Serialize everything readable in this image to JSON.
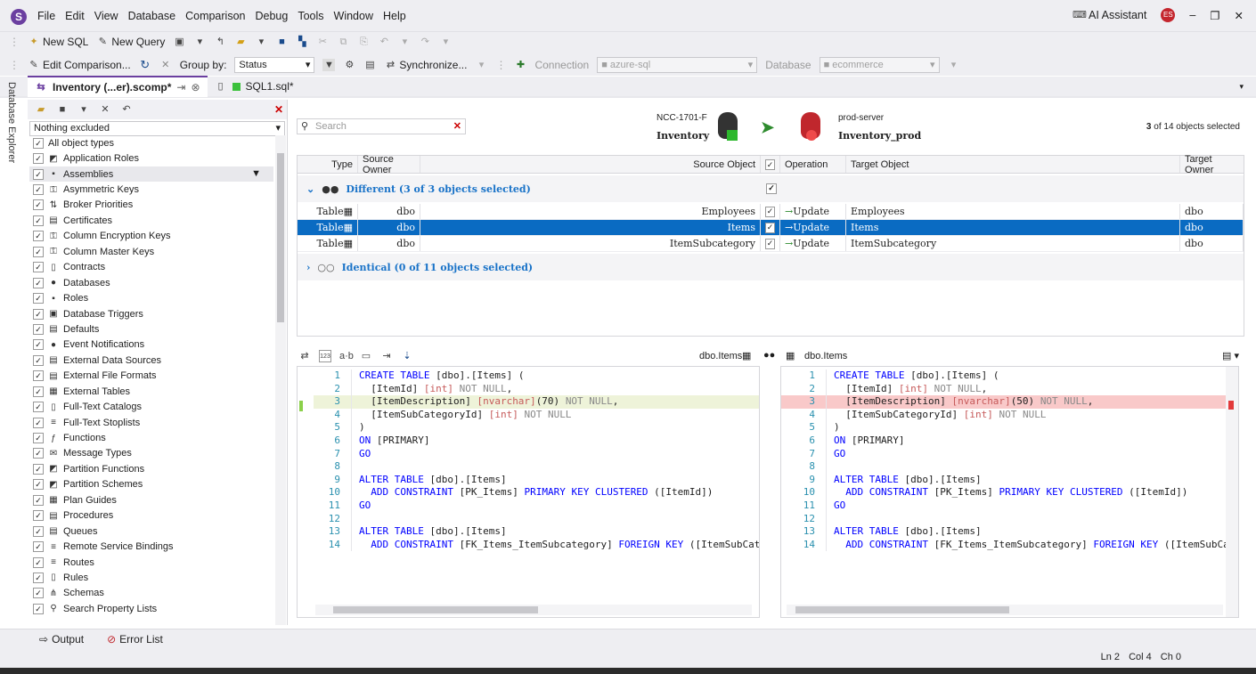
{
  "menu": {
    "items": [
      "File",
      "Edit",
      "View",
      "Database",
      "Comparison",
      "Debug",
      "Tools",
      "Window",
      "Help"
    ],
    "ai_assistant": "AI Assistant",
    "avatar_initials": "ES"
  },
  "toolbar1": {
    "new_sql": "New SQL",
    "new_query": "New Query"
  },
  "toolbar2": {
    "edit_comparison": "Edit Comparison...",
    "group_by_label": "Group by:",
    "group_by_value": "Status",
    "synchronize": "Synchronize...",
    "connection_label": "Connection",
    "connection_value": "azure-sql",
    "database_label": "Database",
    "database_value": "ecommerce"
  },
  "tabs": [
    {
      "label": "Inventory (...er).scomp*"
    },
    {
      "label": "SQL1.sql*"
    }
  ],
  "side_strip": "Database Explorer",
  "left_panel": {
    "filter_value": "Nothing excluded",
    "items": [
      "All object types",
      "Application Roles",
      "Assemblies",
      "Asymmetric Keys",
      "Broker Priorities",
      "Certificates",
      "Column Encryption Keys",
      "Column Master Keys",
      "Contracts",
      "Databases",
      "Roles",
      "Database Triggers",
      "Defaults",
      "Event Notifications",
      "External Data Sources",
      "External File Formats",
      "External Tables",
      "Full-Text Catalogs",
      "Full-Text Stoplists",
      "Functions",
      "Message Types",
      "Partition Functions",
      "Partition Schemes",
      "Plan Guides",
      "Procedures",
      "Queues",
      "Remote Service Bindings",
      "Routes",
      "Rules",
      "Schemas",
      "Search Property Lists"
    ]
  },
  "comparison": {
    "search_placeholder": "Search",
    "source_server": "NCC-1701-F",
    "source_db": "Inventory",
    "target_server": "prod-server",
    "target_db": "Inventory_prod",
    "selected_count": "3",
    "selected_suffix": "of 14 objects selected"
  },
  "grid": {
    "headers": {
      "type": "Type",
      "source_owner": "Source Owner",
      "source_object": "Source Object",
      "operation": "Operation",
      "target_object": "Target Object",
      "target_owner": "Target Owner"
    },
    "group_different": "Different (3 of 3 objects selected)",
    "group_identical": "Identical (0 of 11 objects selected)",
    "rows": [
      {
        "type": "Table",
        "source_owner": "dbo",
        "source_object": "Employees",
        "operation": "Update",
        "target_object": "Employees",
        "target_owner": "dbo"
      },
      {
        "type": "Table",
        "source_owner": "dbo",
        "source_object": "Items",
        "operation": "Update",
        "target_object": "Items",
        "target_owner": "dbo"
      },
      {
        "type": "Table",
        "source_owner": "dbo",
        "source_object": "ItemSubcategory",
        "operation": "Update",
        "target_object": "ItemSubcategory",
        "target_owner": "dbo"
      }
    ]
  },
  "diff": {
    "left_title": "dbo.Items",
    "right_title": "dbo.Items",
    "left_lines": [
      "CREATE TABLE [dbo].[Items] (",
      "  [ItemId] [int] NOT NULL,",
      "  [ItemDescription] [nvarchar](70) NOT NULL,",
      "  [ItemSubCategoryId] [int] NOT NULL",
      ")",
      "ON [PRIMARY]",
      "GO",
      "",
      "ALTER TABLE [dbo].[Items]",
      "  ADD CONSTRAINT [PK_Items] PRIMARY KEY CLUSTERED ([ItemId])",
      "GO",
      "",
      "ALTER TABLE [dbo].[Items]",
      "  ADD CONSTRAINT [FK_Items_ItemSubcategory] FOREIGN KEY ([ItemSubCate"
    ],
    "right_lines": [
      "CREATE TABLE [dbo].[Items] (",
      "  [ItemId] [int] NOT NULL,",
      "  [ItemDescription] [nvarchar](50) NOT NULL,",
      "  [ItemSubCategoryId] [int] NOT NULL",
      ")",
      "ON [PRIMARY]",
      "GO",
      "",
      "ALTER TABLE [dbo].[Items]",
      "  ADD CONSTRAINT [PK_Items] PRIMARY KEY CLUSTERED ([ItemId])",
      "GO",
      "",
      "ALTER TABLE [dbo].[Items]",
      "  ADD CONSTRAINT [FK_Items_ItemSubcategory] FOREIGN KEY ([ItemSubCate"
    ]
  },
  "bottom": {
    "output": "Output",
    "error_list": "Error List"
  },
  "status": {
    "ln": "Ln 2",
    "col": "Col 4",
    "ch": "Ch 0"
  },
  "colors": {
    "accent": "#6b3fa0",
    "selection": "#0a6bc2",
    "added": "#eef3d9",
    "removed": "#f9c9c9"
  }
}
